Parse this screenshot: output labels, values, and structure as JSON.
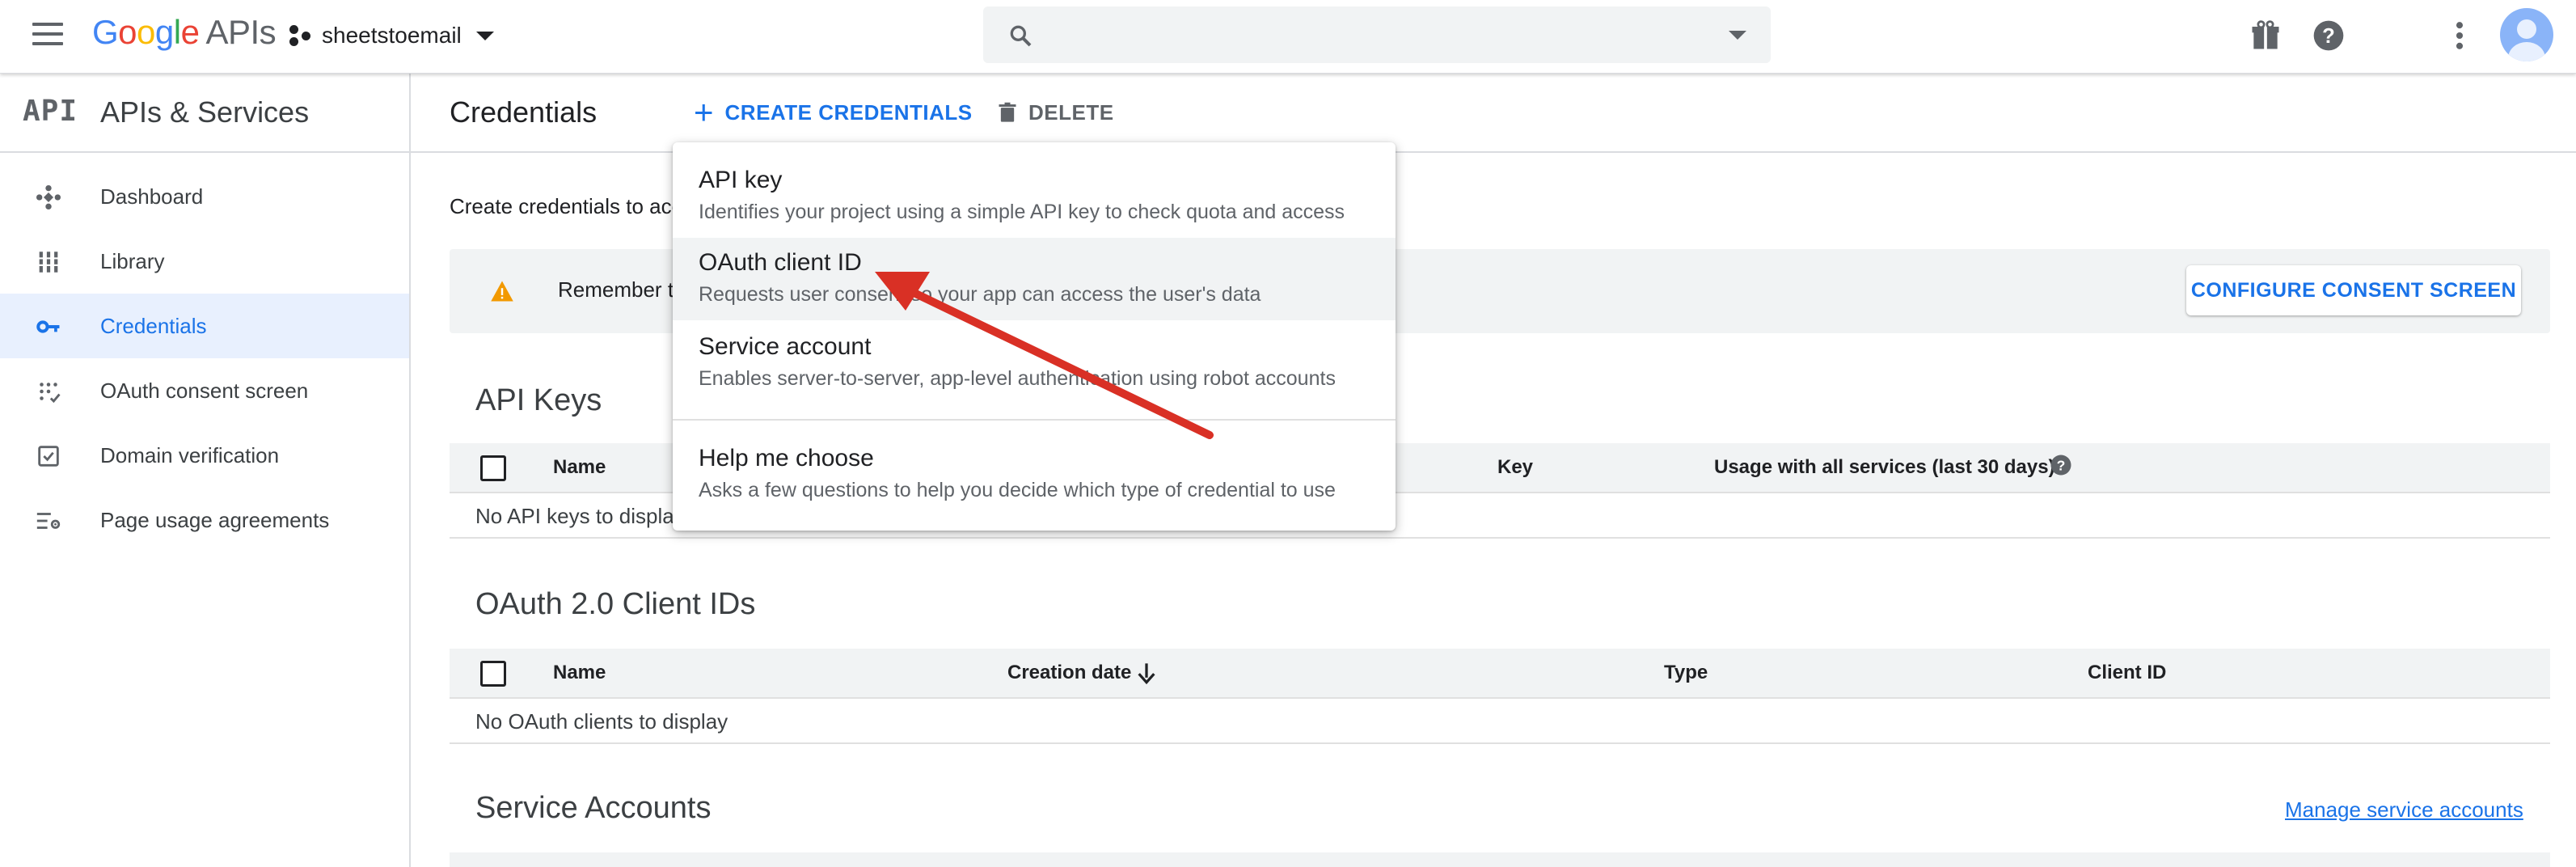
{
  "topbar": {
    "logo_google_letters": [
      "G",
      "o",
      "o",
      "g",
      "l",
      "e"
    ],
    "logo_apis": "APIs",
    "project_name": "sheetstoemail",
    "search_placeholder": ""
  },
  "sidebar": {
    "header_logo": "API",
    "header_title": "APIs & Services",
    "items": [
      {
        "label": "Dashboard",
        "icon": "dashboard-icon"
      },
      {
        "label": "Library",
        "icon": "library-icon"
      },
      {
        "label": "Credentials",
        "icon": "key-icon",
        "active": true
      },
      {
        "label": "OAuth consent screen",
        "icon": "consent-icon"
      },
      {
        "label": "Domain verification",
        "icon": "domain-check-icon"
      },
      {
        "label": "Page usage agreements",
        "icon": "settings-list-icon"
      }
    ]
  },
  "main": {
    "title": "Credentials",
    "create_label": "CREATE CREDENTIALS",
    "delete_label": "DELETE",
    "intro_text": "Create credentials to acc",
    "banner_text": "Remember t",
    "banner_button": "CONFIGURE CONSENT SCREEN",
    "api_keys": {
      "title": "API Keys",
      "columns": [
        "Name",
        "Key",
        "Usage with all services (last 30 days)"
      ],
      "empty": "No API keys to displa"
    },
    "oauth": {
      "title": "OAuth 2.0 Client IDs",
      "columns": [
        "Name",
        "Creation date",
        "Type",
        "Client ID"
      ],
      "empty": "No OAuth clients to display"
    },
    "service_accounts": {
      "title": "Service Accounts",
      "manage_link": "Manage service accounts"
    }
  },
  "menu": {
    "items": [
      {
        "title": "API key",
        "desc": "Identifies your project using a simple API key to check quota and access"
      },
      {
        "title": "OAuth client ID",
        "desc": "Requests user consent so your app can access the user's data"
      },
      {
        "title": "Service account",
        "desc": "Enables server-to-server, app-level authentication using robot accounts"
      },
      {
        "title": "Help me choose",
        "desc": "Asks a few questions to help you decide which type of credential to use"
      }
    ]
  },
  "colors": {
    "accent": "#1a73e8",
    "warning": "#f29900",
    "annotation_arrow": "#d93025"
  }
}
